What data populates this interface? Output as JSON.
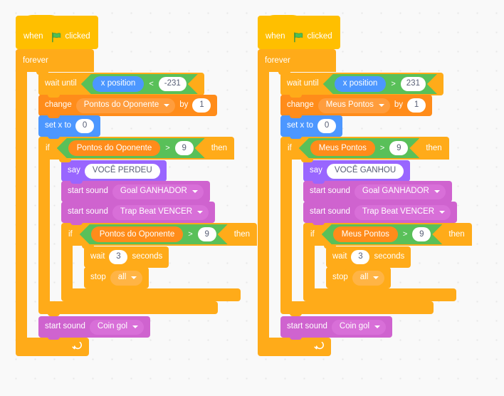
{
  "canvas": {
    "background_color": "#F9F9F9",
    "grid_dot_color": "#E8E8E8"
  },
  "palette": {
    "events": "#FFBF00",
    "control": "#FFAB19",
    "motion": "#4C97FF",
    "looks": "#9966FF",
    "sound": "#CF63CF",
    "variables": "#FF8C1A",
    "operators": "#59C059",
    "input_text": "#575E75"
  },
  "scripts": [
    {
      "id": "opponent-script",
      "hat": {
        "word_when": "when",
        "icon": "green-flag-icon",
        "word_clicked": "clicked"
      },
      "forever_label": "forever",
      "wait_until": {
        "label": "wait until",
        "reporter": "x position",
        "operator": "<",
        "value": "-231"
      },
      "change_var": {
        "label": "change",
        "variable": "Pontos do Oponente",
        "by_label": "by",
        "value": "1"
      },
      "set_x": {
        "label": "set x to",
        "value": "0"
      },
      "if_outer": {
        "if_label": "if",
        "variable": "Pontos do Oponente",
        "operator": ">",
        "value": "9",
        "then_label": "then"
      },
      "say": {
        "label": "say",
        "message": "VOCÊ PERDEU"
      },
      "sound_1": {
        "label": "start sound",
        "sound": "Goal GANHADOR"
      },
      "sound_2": {
        "label": "start sound",
        "sound": "Trap Beat VENCER"
      },
      "if_inner": {
        "if_label": "if",
        "variable": "Pontos do Oponente",
        "operator": ">",
        "value": "9",
        "then_label": "then"
      },
      "wait": {
        "label": "wait",
        "value": "3",
        "unit": "seconds"
      },
      "stop": {
        "label": "stop",
        "option": "all"
      },
      "sound_3": {
        "label": "start sound",
        "sound": "Coin gol"
      }
    },
    {
      "id": "player-script",
      "hat": {
        "word_when": "when",
        "icon": "green-flag-icon",
        "word_clicked": "clicked"
      },
      "forever_label": "forever",
      "wait_until": {
        "label": "wait until",
        "reporter": "x position",
        "operator": ">",
        "value": "231"
      },
      "change_var": {
        "label": "change",
        "variable": "Meus Pontos",
        "by_label": "by",
        "value": "1"
      },
      "set_x": {
        "label": "set x to",
        "value": "0"
      },
      "if_outer": {
        "if_label": "if",
        "variable": "Meus Pontos",
        "operator": ">",
        "value": "9",
        "then_label": "then"
      },
      "say": {
        "label": "say",
        "message": "VOCÊ GANHOU"
      },
      "sound_1": {
        "label": "start sound",
        "sound": "Goal GANHADOR"
      },
      "sound_2": {
        "label": "start sound",
        "sound": "Trap Beat VENCER"
      },
      "if_inner": {
        "if_label": "if",
        "variable": "Meus Pontos",
        "operator": ">",
        "value": "9",
        "then_label": "then"
      },
      "wait": {
        "label": "wait",
        "value": "3",
        "unit": "seconds"
      },
      "stop": {
        "label": "stop",
        "option": "all"
      },
      "sound_3": {
        "label": "start sound",
        "sound": "Coin gol"
      }
    }
  ]
}
